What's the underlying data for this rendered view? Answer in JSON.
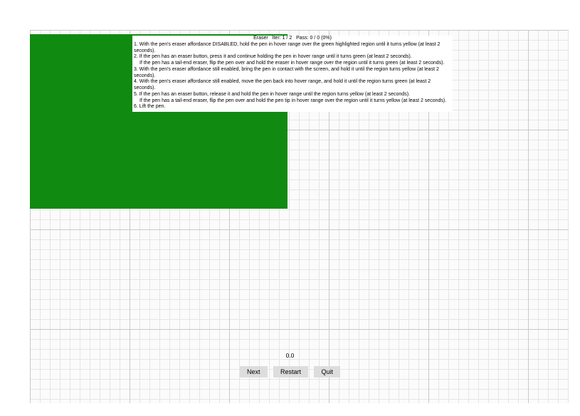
{
  "header": {
    "test_name": "Eraser",
    "iter_label": "Iter:",
    "iter_current": 1,
    "iter_total": 2,
    "pass_label": "Pass:",
    "pass_current": 0,
    "pass_total": 0,
    "pass_pct": "(0%)"
  },
  "instructions": [
    {
      "n": "1.",
      "text": "With the pen's eraser affordance DISABLED, hold the pen in hover range over the green highlighted region until it turns yellow (at least 2 seconds)."
    },
    {
      "n": "2.",
      "text": "If the pen has an eraser button, press it and continue holding the pen in hover range until it turns green (at least 2 seconds)."
    },
    {
      "n": "",
      "text": "If the pen has a tail-end eraser, flip the pen over and hold the eraser in hover range over the region until it turns green (at least 2 seconds).",
      "indent": true
    },
    {
      "n": "3.",
      "text": "With the pen's eraser affordance still enabled, bring the pen in contact with the screen, and hold it until the region turns yellow (at least 2 seconds)."
    },
    {
      "n": "4.",
      "text": "With the pen's eraser affordance still enabled, move the pen back into hover range, and hold it until the region turns green (at least 2 seconds)."
    },
    {
      "n": "5.",
      "text": "If the pen has an eraser button, release it and hold the pen in hover range until the region turns yellow (at least 2 seconds)."
    },
    {
      "n": "",
      "text": "If the pen has a tail-end eraser, flip the pen over and hold the pen tip in hover range over the region until it turns yellow (at least 2 seconds).",
      "indent": true
    },
    {
      "n": "6.",
      "text": "Lift the pen."
    }
  ],
  "readout": {
    "value": "0.0"
  },
  "buttons": {
    "next": "Next",
    "restart": "Restart",
    "quit": "Quit"
  },
  "colors": {
    "highlight_green": "#118a11",
    "button_bg": "#dddddd"
  }
}
